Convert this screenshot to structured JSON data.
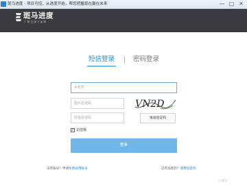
{
  "window": {
    "title": "斑马进度 - 项目可控，从进度开始，帮您把握现在赢在未来",
    "minimize_glyph": "—",
    "maximize_glyph": "□",
    "close_glyph": "✕"
  },
  "header": {
    "logo_text": "斑马进度",
    "logo_tagline": "广 联 达 旗 下 品 牌"
  },
  "tabs": {
    "sms_login": "短信登录",
    "password_login": "密码登录"
  },
  "form": {
    "phone_placeholder": "手机号",
    "image_code_placeholder": "图片验证码",
    "sms_code_placeholder": "短信验证码",
    "captcha_text": "VN2D",
    "send_code_label": "发送验证码",
    "remember_label": "记住我",
    "remember_checked": true,
    "login_label": "登录"
  },
  "footer": {
    "no_account_text": "没有账号？申请",
    "trial_link": "免费试用账号",
    "has_account_text": "已有加密狗？",
    "dongle_link": "使用加密狗"
  },
  "watermark": "亿速云"
}
